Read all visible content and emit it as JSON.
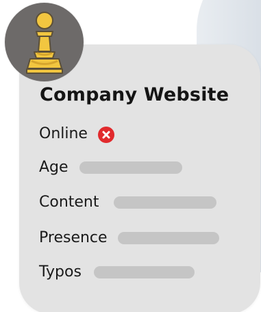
{
  "card": {
    "title": "Company Website",
    "rows": [
      {
        "label": "Online",
        "status": "offline",
        "status_icon": "close-icon"
      },
      {
        "label": "Age"
      },
      {
        "label": "Content"
      },
      {
        "label": "Presence"
      },
      {
        "label": "Typos"
      }
    ]
  },
  "avatar": {
    "icon": "chess-pawn-icon",
    "accent_color": "#f2c640"
  },
  "colors": {
    "card_background": "#e3e3e3",
    "avatar_background": "#6d6a69",
    "status_red": "#e12a2d",
    "placeholder_bar": "#c5c5c5"
  }
}
